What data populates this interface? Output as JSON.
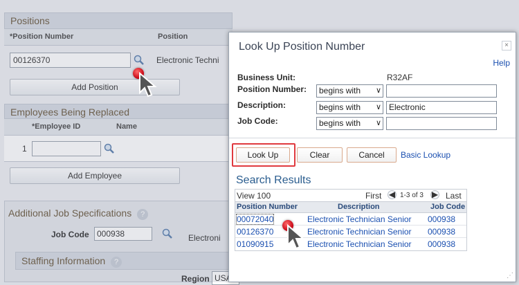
{
  "background": {
    "positions": {
      "title": "Positions",
      "col_position_number": "*Position Number",
      "col_position": "Position",
      "position_number_value": "00126370",
      "position_desc": "Electronic Techni",
      "add_position": "Add Position"
    },
    "employees": {
      "title": "Employees Being Replaced",
      "col_employee_id": "*Employee ID",
      "col_name": "Name",
      "row_number": "1",
      "add_employee": "Add Employee"
    },
    "additional": {
      "title": "Additional Job Specifications",
      "job_code_label": "Job Code",
      "job_code_value": "000938",
      "job_code_desc": "Electroni",
      "staffing_title": "Staffing Information",
      "region_label": "Region",
      "region_value": "USA"
    }
  },
  "modal": {
    "title": "Look Up Position Number",
    "close": "×",
    "help": "Help",
    "business_unit_label": "Business Unit:",
    "business_unit_value": "R32AF",
    "position_number_label": "Position Number:",
    "position_number_op": "begins with",
    "position_number_value": "",
    "description_label": "Description:",
    "description_op": "begins with",
    "description_value": "Electronic",
    "job_code_label": "Job Code:",
    "job_code_op": "begins with",
    "job_code_value": "",
    "look_up": "Look Up",
    "clear": "Clear",
    "cancel": "Cancel",
    "basic_lookup": "Basic Lookup",
    "search_results_title": "Search Results",
    "view": "View 100",
    "first": "First",
    "range": "1-3 of 3",
    "last": "Last",
    "columns": [
      "Position Number",
      "Description",
      "Job Code"
    ],
    "rows": [
      {
        "position": "00072040",
        "description": "Electronic Technician Senior",
        "job_code": "000938"
      },
      {
        "position": "00126370",
        "description": "Electronic Technician Senior",
        "job_code": "000938"
      },
      {
        "position": "01090915",
        "description": "Electronic Technician Senior",
        "job_code": "000938"
      }
    ]
  },
  "colors": {
    "highlight": "#e0393e",
    "link": "#1a4fb0",
    "section_header_text": "#6b5a3f"
  }
}
